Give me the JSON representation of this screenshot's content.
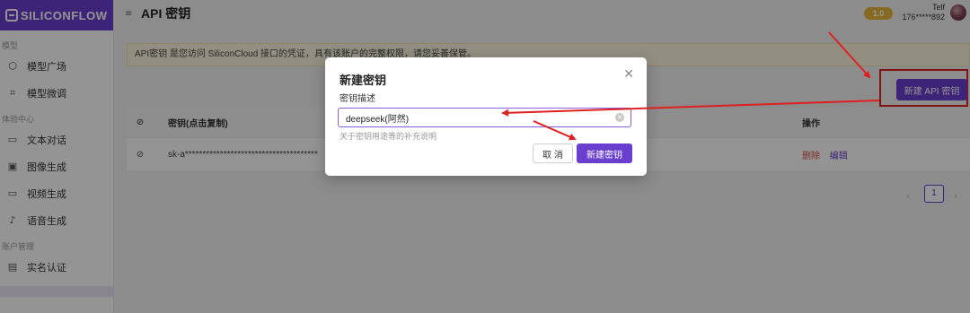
{
  "brand": {
    "name": "SILICONFLOW"
  },
  "sidebar": {
    "groups": [
      {
        "label": "模型",
        "items": [
          {
            "label": "模型广场",
            "icon": "cube-icon"
          },
          {
            "label": "模型微调",
            "icon": "tune-icon"
          }
        ]
      },
      {
        "label": "体验中心",
        "items": [
          {
            "label": "文本对话",
            "icon": "chat-icon"
          },
          {
            "label": "图像生成",
            "icon": "image-icon"
          },
          {
            "label": "视频生成",
            "icon": "video-icon"
          },
          {
            "label": "语音生成",
            "icon": "mic-icon"
          }
        ]
      },
      {
        "label": "账户管理",
        "items": [
          {
            "label": "实名认证",
            "icon": "id-card-icon"
          }
        ]
      }
    ]
  },
  "header": {
    "title": "API 密钥",
    "vip_level": "1.0",
    "user_name": "Telf",
    "user_phone": "176*****892"
  },
  "notice": "API密钥 是您访问 SiliconCloud 接口的凭证，具有该账户的完整权限，请您妥善保管。",
  "toolbar": {
    "new_key_label": "新建 API 密钥"
  },
  "table": {
    "headers": {
      "key": "密钥(点击复制)",
      "actions": "操作"
    },
    "rows": [
      {
        "key": "sk-a**************************************",
        "delete": "删除",
        "edit": "编辑"
      }
    ]
  },
  "pagination": {
    "current": "1",
    "prev": "‹",
    "next": "›"
  },
  "modal": {
    "title": "新建密钥",
    "field_label": "密钥描述",
    "field_value": "deepseek(阿然)",
    "hint": "关于密钥用途等的补充说明",
    "cancel_label": "取 消",
    "create_label": "新建密钥"
  },
  "colors": {
    "accent": "#6a3fd0",
    "annotation": "#e02020",
    "danger": "#e04a4a"
  }
}
